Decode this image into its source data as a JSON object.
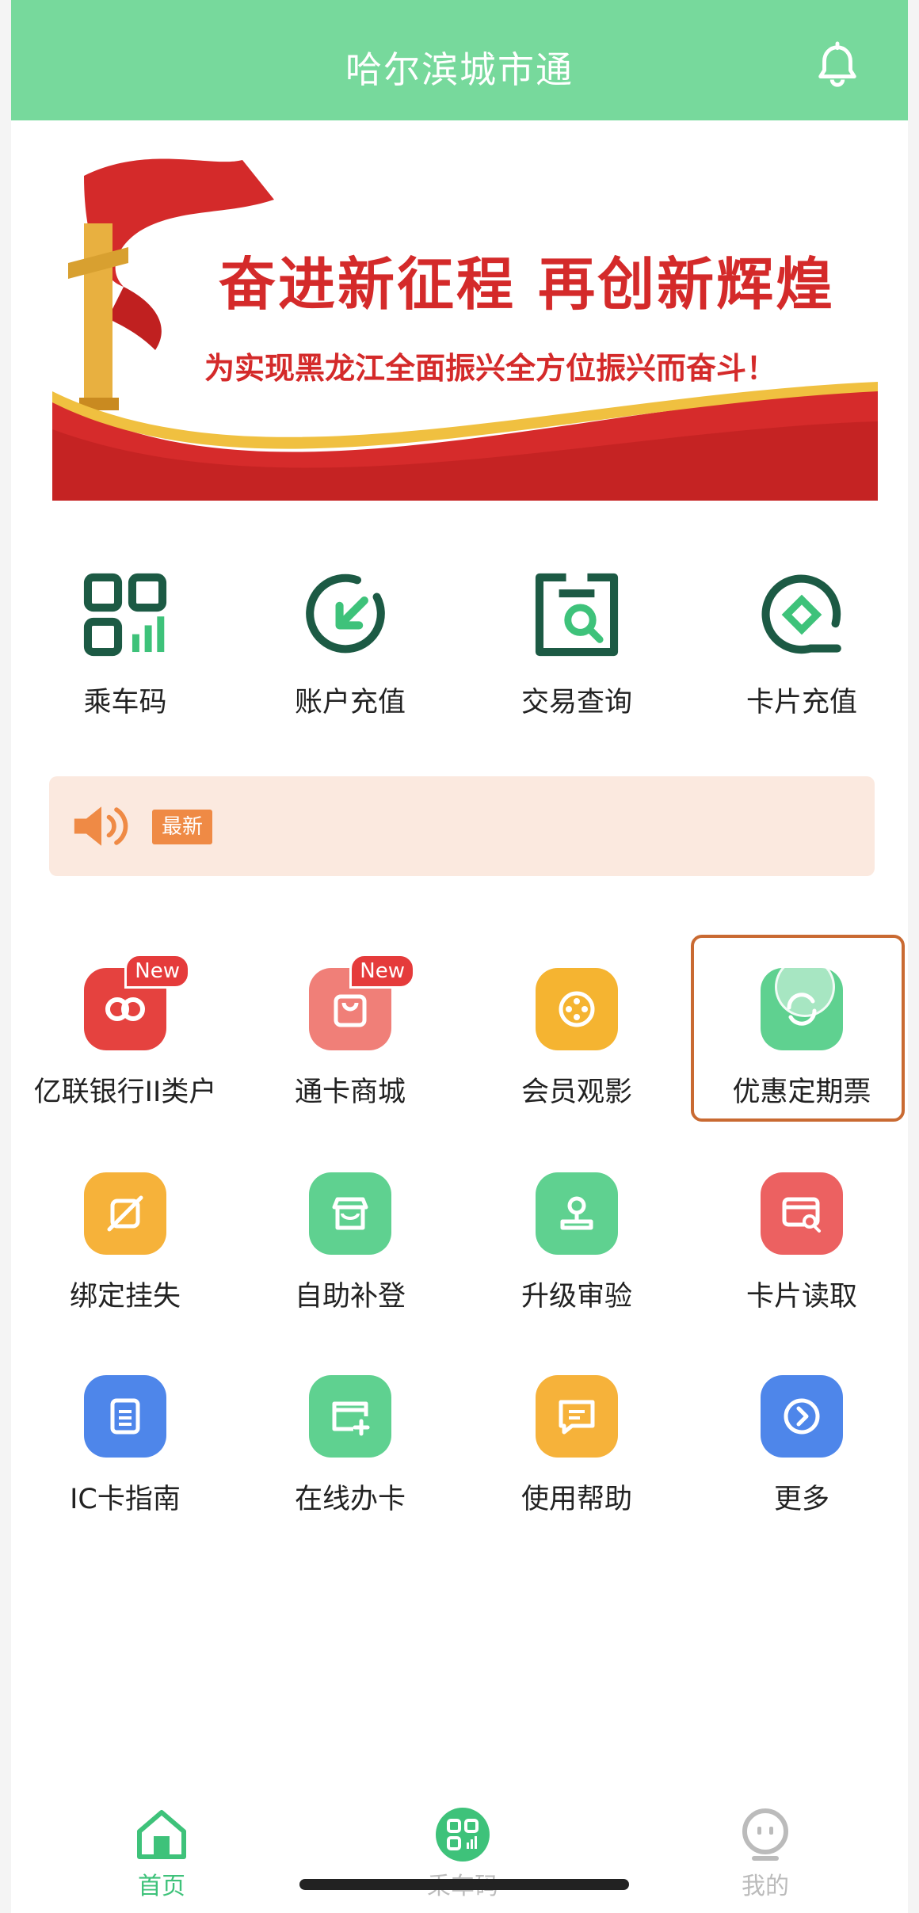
{
  "header": {
    "title": "哈尔滨城市通",
    "bell_icon": "bell-icon"
  },
  "banner": {
    "title": "奋进新征程  再创新辉煌",
    "subtitle": "为实现黑龙江全面振兴全方位振兴而奋斗！"
  },
  "quick": [
    {
      "label": "乘车码",
      "icon": "qr-code-icon"
    },
    {
      "label": "账户充值",
      "icon": "recharge-icon"
    },
    {
      "label": "交易查询",
      "icon": "transaction-search-icon"
    },
    {
      "label": "卡片充值",
      "icon": "card-recharge-icon"
    }
  ],
  "notice": {
    "badge": "最新",
    "icon": "speaker-icon"
  },
  "services": [
    {
      "label": "亿联银行II类户",
      "badge": "New",
      "color": "#e5423f"
    },
    {
      "label": "通卡商城",
      "badge": "New",
      "color": "#f07f78"
    },
    {
      "label": "会员观影",
      "badge": "",
      "color": "#f5b431"
    },
    {
      "label": "优惠定期票",
      "badge": "",
      "color": "#5fd190"
    },
    {
      "label": "绑定挂失",
      "badge": "",
      "color": "#f6b23a"
    },
    {
      "label": "自助补登",
      "badge": "",
      "color": "#5fd190"
    },
    {
      "label": "升级审验",
      "badge": "",
      "color": "#5fd190"
    },
    {
      "label": "卡片读取",
      "badge": "",
      "color": "#ec6161"
    },
    {
      "label": "IC卡指南",
      "badge": "",
      "color": "#4e86ea"
    },
    {
      "label": "在线办卡",
      "badge": "",
      "color": "#5fd190"
    },
    {
      "label": "使用帮助",
      "badge": "",
      "color": "#f6b23a"
    },
    {
      "label": "更多",
      "badge": "",
      "color": "#4e86ea"
    }
  ],
  "tabs": [
    {
      "label": "首页",
      "color": "#3ec27a"
    },
    {
      "label": "乘车码",
      "color": "#bbbbbb"
    },
    {
      "label": "我的",
      "color": "#bbbbbb"
    }
  ],
  "colors": {
    "header": "#77d99c",
    "accent_green": "#1c5a44",
    "highlight": "#c96a32"
  }
}
